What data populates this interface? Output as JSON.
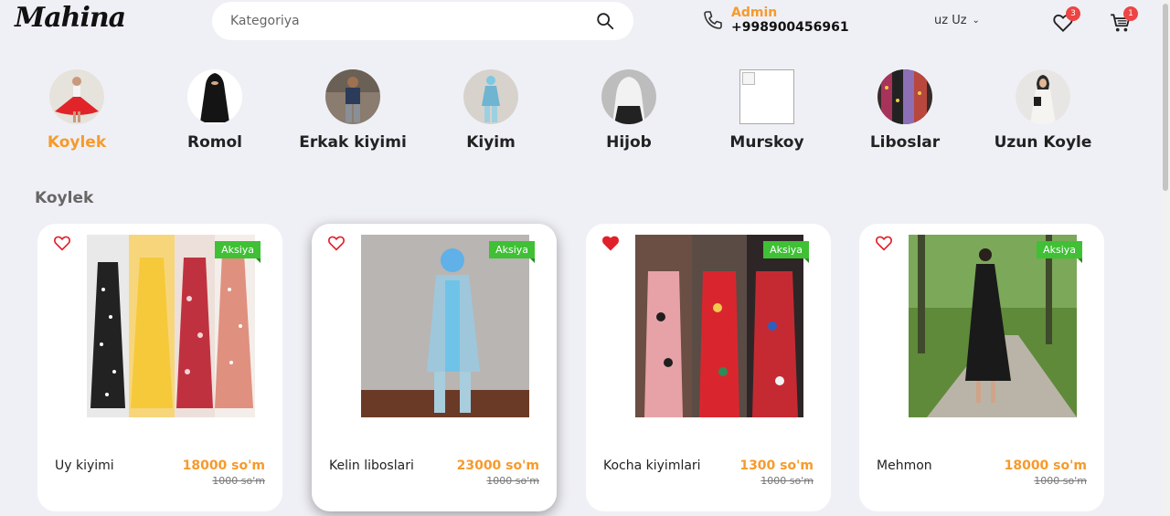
{
  "header": {
    "logo": "Mahina",
    "search_placeholder": "Kategoriya",
    "contact_name": "Admin",
    "contact_phone": "+998900456961",
    "language": "uz Uz",
    "wishlist_count": "3",
    "cart_count": "1"
  },
  "categories": [
    {
      "label": "Koylek",
      "active": true
    },
    {
      "label": "Romol",
      "active": false
    },
    {
      "label": "Erkak kiyimi",
      "active": false
    },
    {
      "label": "Kiyim",
      "active": false
    },
    {
      "label": "Hijob",
      "active": false
    },
    {
      "label": "Murskoy",
      "active": false
    },
    {
      "label": "Liboslar",
      "active": false
    },
    {
      "label": "Uzun Koyle",
      "active": false
    }
  ],
  "section_title": "Koylek",
  "products": [
    {
      "name": "Uy kiyimi",
      "price": "18000 so'm",
      "old_price": "1000 so'm",
      "tag": "Aksiya",
      "liked": false
    },
    {
      "name": "Kelin liboslari",
      "price": "23000 so'm",
      "old_price": "1000 so'm",
      "tag": "Aksiya",
      "liked": false
    },
    {
      "name": "Kocha kiyimlari",
      "price": "1300 so'm",
      "old_price": "1000 so'm",
      "tag": "Aksiya",
      "liked": true
    },
    {
      "name": "Mehmon",
      "price": "18000 so'm",
      "old_price": "1000 so'm",
      "tag": "Aksiya",
      "liked": false
    }
  ],
  "colors": {
    "accent": "#f79a2c",
    "tag_green": "#3fc035",
    "badge_red": "#ee4444",
    "heart_red": "#e0202a",
    "background": "#eff0f5"
  }
}
